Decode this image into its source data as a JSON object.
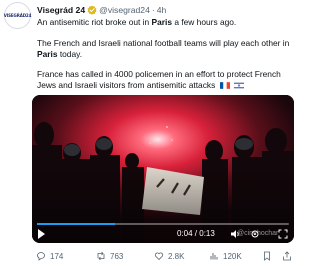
{
  "author": {
    "avatar_text": "VISEGRÁD24",
    "name": "Visegrád 24",
    "handle": "@visegrad24",
    "separator": "·",
    "time": "4h"
  },
  "tweet": {
    "line1_a": "An antisemitic riot broke out in ",
    "line1_b": "Paris",
    "line1_c": " a few hours ago.",
    "line2_a": "The French and Israeli national football teams will play each other in ",
    "line2_b": "Paris",
    "line2_c": " today.",
    "line3": "France has called in 4000 policemen in an effort to protect French Jews and Israeli visitors from antisemitic attacks"
  },
  "video": {
    "time_display": "0:04 / 0:13",
    "progress": 0.31,
    "watermark": "@cinehochar"
  },
  "actions": {
    "replies": "174",
    "reposts": "763",
    "likes": "2.8K",
    "views": "120K"
  },
  "colors": {
    "accent": "#1d9bf0",
    "flare": "#ff2a3a",
    "muted": "#536471"
  },
  "icons": [
    "verified-badge-icon",
    "flag-france-icon",
    "flag-israel-icon",
    "play-icon",
    "volume-icon",
    "settings-icon",
    "fullscreen-icon",
    "reply-icon",
    "repost-icon",
    "like-icon",
    "views-icon",
    "bookmark-icon",
    "share-icon"
  ]
}
